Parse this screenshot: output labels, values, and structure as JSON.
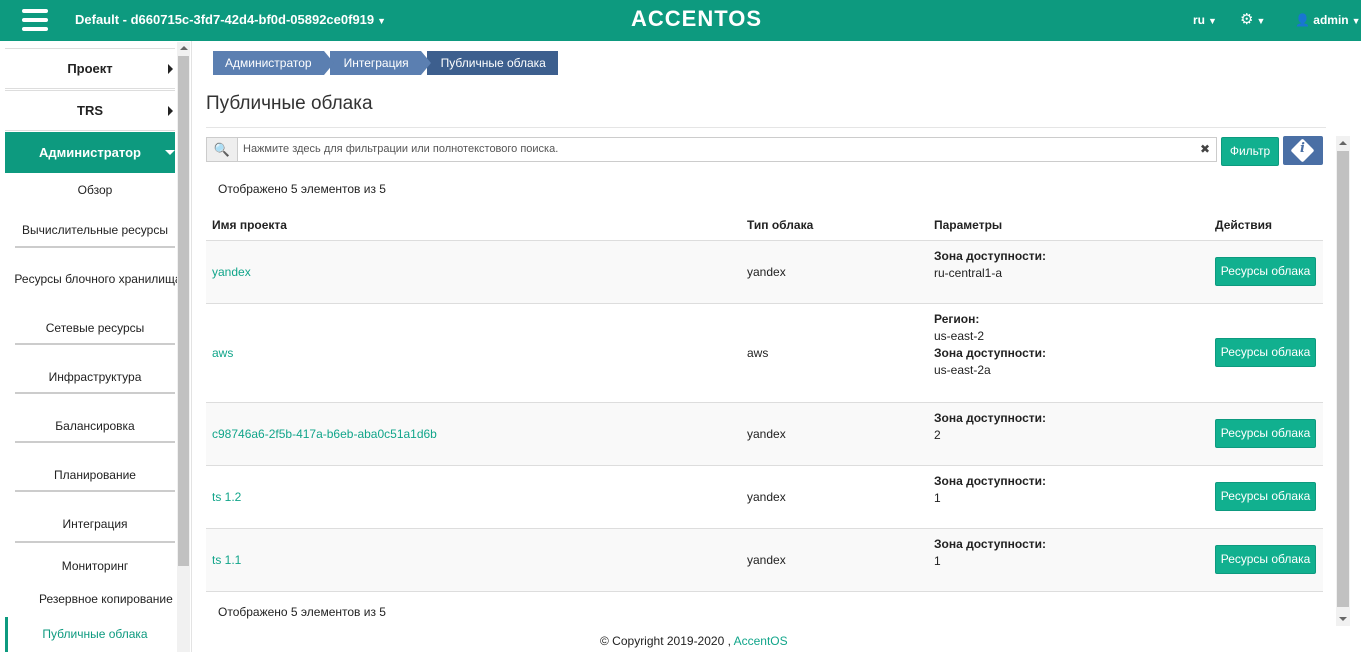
{
  "topbar": {
    "project": "Default - d660715c-3fd7-42d4-bf0d-05892ce0f919",
    "logo": "ACCENTOS",
    "lang": "ru",
    "user": "admin"
  },
  "sidebar": {
    "items": [
      {
        "label": "Проект"
      },
      {
        "label": "TRS"
      },
      {
        "label": "Администратор"
      }
    ],
    "sub_items": [
      {
        "label": "Обзор"
      },
      {
        "label": "Вычислительные ресурсы"
      },
      {
        "label": "Ресурсы блочного хранилища"
      },
      {
        "label": "Сетевые ресурсы"
      },
      {
        "label": "Инфраструктура"
      },
      {
        "label": "Балансировка"
      },
      {
        "label": "Планирование"
      },
      {
        "label": "Интеграция"
      },
      {
        "label": "Мониторинг"
      },
      {
        "label": "Резервное копирование"
      },
      {
        "label": "Публичные облака"
      }
    ]
  },
  "breadcrumb": [
    "Администратор",
    "Интеграция",
    "Публичные облака"
  ],
  "page": {
    "title": "Публичные облака",
    "search_placeholder": "Нажмите здесь для фильтрации или полнотекстового поиска.",
    "filter_label": "Фильтр",
    "count_text": "Отображено 5 элементов из 5"
  },
  "table": {
    "columns": [
      "Имя проекта",
      "Тип облака",
      "Параметры",
      "Действия"
    ],
    "action_label": "Ресурсы облака",
    "rows": [
      {
        "name": "yandex",
        "type": "yandex",
        "params": [
          [
            "Зона доступности:",
            "ru-central1-a"
          ]
        ]
      },
      {
        "name": "aws",
        "type": "aws",
        "params": [
          [
            "Регион:",
            "us-east-2"
          ],
          [
            "Зона доступности:",
            "us-east-2a"
          ]
        ]
      },
      {
        "name": "c98746a6-2f5b-417a-b6eb-aba0c51a1d6b",
        "type": "yandex",
        "params": [
          [
            "Зона доступности:",
            "2"
          ]
        ]
      },
      {
        "name": "ts 1.2",
        "type": "yandex",
        "params": [
          [
            "Зона доступности:",
            "1"
          ]
        ]
      },
      {
        "name": "ts 1.1",
        "type": "yandex",
        "params": [
          [
            "Зона доступности:",
            "1"
          ]
        ]
      }
    ]
  },
  "footer": {
    "copyright": "© Copyright 2019-2020 ,",
    "link": "AccentOS"
  }
}
